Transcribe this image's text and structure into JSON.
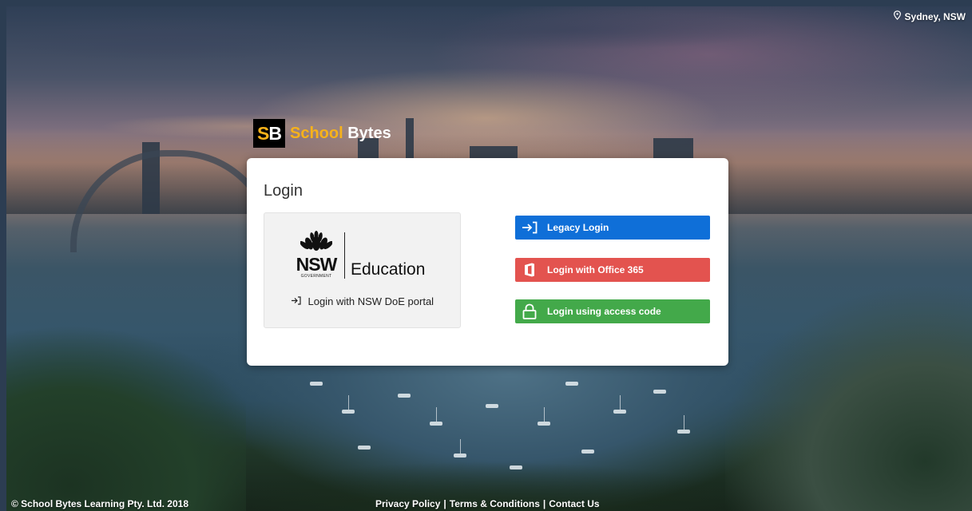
{
  "location": {
    "label": "Sydney, NSW"
  },
  "brand": {
    "mark_first": "S",
    "mark_second": "B",
    "name_first": "School",
    "name_second": "Bytes"
  },
  "login": {
    "title": "Login",
    "nsw": {
      "logo_main": "NSW",
      "logo_sub": "GOVERNMENT",
      "logo_dept": "Education",
      "link_label": "Login with NSW DoE portal"
    },
    "buttons": {
      "legacy": "Legacy Login",
      "office": "Login with Office 365",
      "access_code": "Login using access code"
    }
  },
  "footer": {
    "copyright": "© School Bytes Learning Pty. Ltd. 2018",
    "privacy": "Privacy Policy",
    "terms": "Terms & Conditions",
    "contact": "Contact Us",
    "separator": "|"
  },
  "colors": {
    "legacy_button": "#0f6fd8",
    "office_button": "#e3534f",
    "access_code_button": "#43a94a",
    "brand_accent": "#f7b21a"
  },
  "icons": [
    "map-pin-icon",
    "sign-in-icon",
    "office-icon",
    "lock-icon",
    "waratah-logo-icon"
  ]
}
